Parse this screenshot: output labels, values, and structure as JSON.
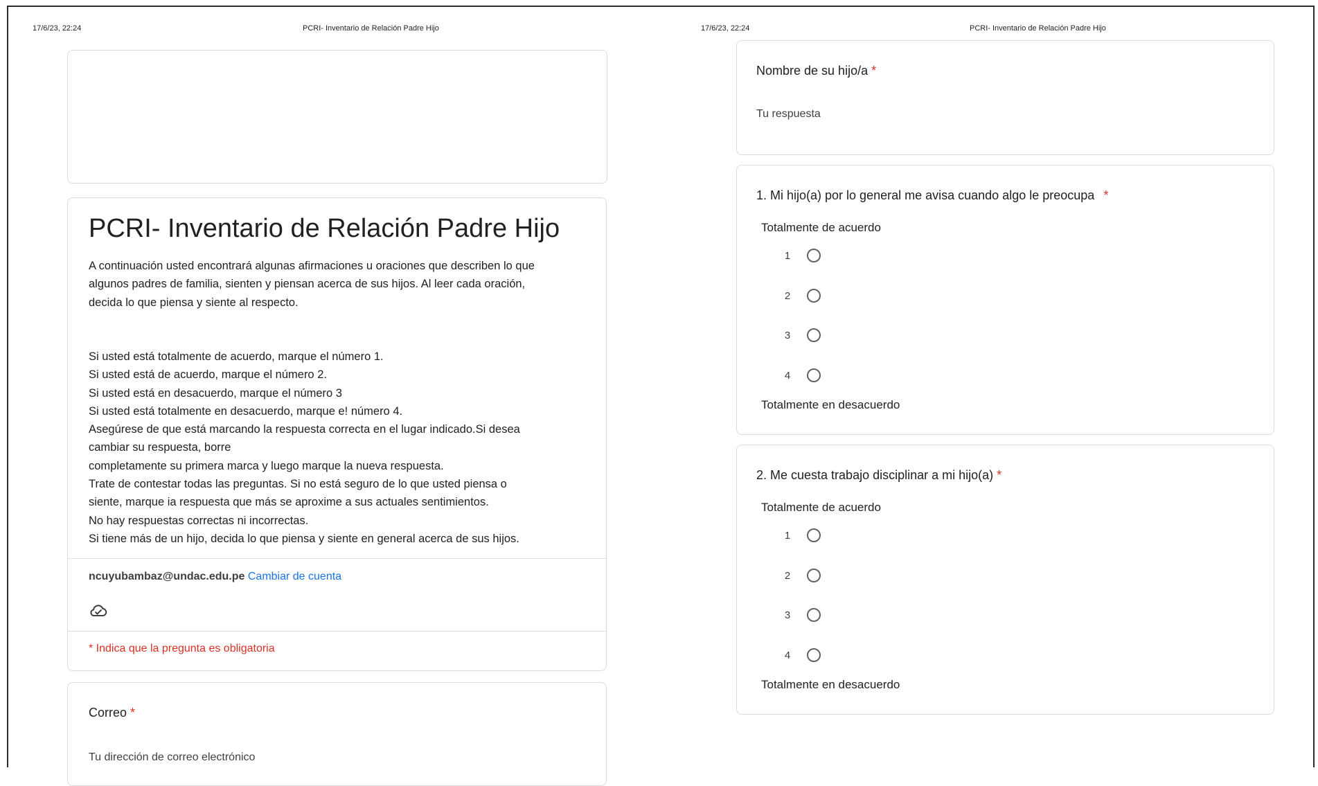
{
  "page_header": {
    "timestamp": "17/6/23, 22:24",
    "doc_title": "PCRI- Inventario de Relación Padre Hijo"
  },
  "form": {
    "title": "PCRI- Inventario de Relación Padre Hijo",
    "intro_lines": [
      "A continuación usted encontrará algunas afirmaciones u oraciones que describen lo que",
      "algunos padres de familia, sienten y piensan acerca de sus hijos. Al leer cada oración,",
      "decida lo que piensa y siente al respecto."
    ],
    "instruction_lines": [
      "Si usted está totalmente de acuerdo, marque el número 1.",
      "Si usted está de acuerdo, marque el número 2.",
      "Si usted está en desacuerdo, marque el número 3",
      "Si usted está totalmente en desacuerdo, marque e! número 4.",
      "Asegúrese de que está marcando la respuesta correcta en el lugar indicado.Si desea",
      "cambiar su respuesta, borre",
      "completamente su primera marca y luego marque la nueva respuesta.",
      "Trate de contestar todas las preguntas. Si no está seguro de lo que usted piensa o",
      "siente, marque ia respuesta que más se aproxime a sus actuales sentimientos.",
      "No hay respuestas correctas ni incorrectas.",
      "Si tiene más de un hijo, decida lo que piensa y siente en general acerca de sus hijos."
    ],
    "account_email": "ncuyubambaz@undac.edu.pe",
    "switch_account": "Cambiar de cuenta",
    "required_note": "* Indica que la pregunta es obligatoria",
    "required_mark": "*"
  },
  "fields": {
    "email": {
      "label": "Correo",
      "placeholder": "Tu dirección de correo electrónico"
    },
    "child_name": {
      "label": "Nombre de su hijo/a",
      "placeholder": "Tu respuesta"
    }
  },
  "questions": [
    {
      "title": "1. Mi hijo(a) por lo general me avisa cuando algo le preocupa",
      "low_label": "Totalmente de acuerdo",
      "high_label": "Totalmente en desacuerdo",
      "options": [
        "1",
        "2",
        "3",
        "4"
      ]
    },
    {
      "title": "2. Me cuesta trabajo disciplinar a mi hijo(a)",
      "low_label": "Totalmente de acuerdo",
      "high_label": "Totalmente en desacuerdo",
      "options": [
        "1",
        "2",
        "3",
        "4"
      ]
    }
  ],
  "icons": {
    "cloud": "cloud-check-icon"
  },
  "colors": {
    "required": "#d93025",
    "link": "#1a73e8",
    "border": "#dadce0"
  }
}
